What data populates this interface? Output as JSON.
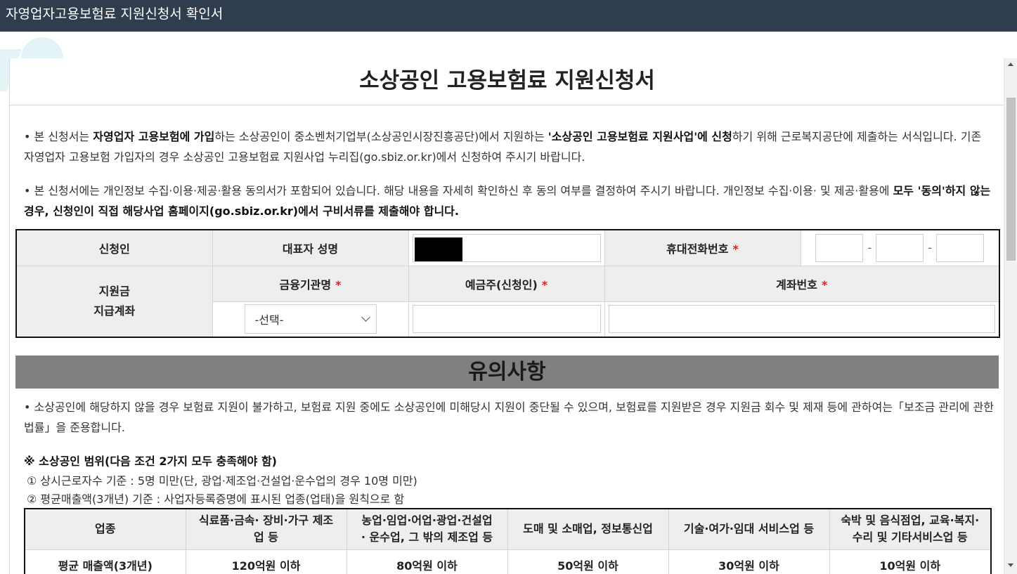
{
  "window": {
    "title": "자영업자고용보험료 지원신청서 확인서"
  },
  "document": {
    "title": "소상공인 고용보험료 지원신청서",
    "intro1": [
      {
        "t": "• 본 신청서는 ",
        "b": false
      },
      {
        "t": "자영업자 고용보험에 가입",
        "b": true
      },
      {
        "t": "하는 소상공인이 중소벤처기업부(소상공인시장진흥공단)에서 지원하는 ",
        "b": false
      },
      {
        "t": "'소상공인 고용보험료 지원사업'에 신청",
        "b": true
      },
      {
        "t": "하기 위해 근로복지공단에 제출하는 서식입니다. 기존 자영업자 고용보험 가입자의 경우 소상공인 고용보험료 지원사업 누리집(go.sbiz.or.kr)에서 신청하여 주시기 바랍니다.",
        "b": false
      }
    ],
    "intro2": [
      {
        "t": "• 본 신청서에는 개인정보 수집·이용·제공·활용 동의서가 포함되어 있습니다. 해당 내용을 자세히 확인하신 후 동의 여부를 결정하여 주시기 바랍니다. 개인정보 수집·이용· 및 제공·활용에 ",
        "b": false
      },
      {
        "t": "모두 '동의'하지 않는 경우, 신청인이 직접 해당사업 홈페이지(go.sbiz.or.kr)에서 구비서류를 제출해야 합니다.",
        "b": true
      }
    ]
  },
  "form": {
    "applicant_label": "신청인",
    "rep_name_label": "대표자 성명",
    "rep_name_value": "",
    "phone_label": "휴대전화번호",
    "required_mark": "*",
    "phone_dash": "-",
    "phone_parts": [
      "",
      "",
      ""
    ],
    "account_section_label_1": "지원금",
    "account_section_label_2": "지급계좌",
    "bank_label": "금융기관명",
    "holder_label": "예금주(신청인)",
    "account_label": "계좌번호",
    "bank_select_value": "-선택-",
    "holder_value": "",
    "account_value": ""
  },
  "notice": {
    "header": "유의사항",
    "text": "• 소상공인에 해당하지 않을 경우 보험료 지원이 불가하고, 보험료 지원 중에도 소상공인에 미해당시 지원이 중단될 수 있으며, 보험료를 지원받은 경우 지원금 회수 및 제재 등에 관하여는「보조금 관리에 관한 법률」을 준용합니다.",
    "scope_title": "※ 소상공인 범위(다음 조건 2가지 모두 충족해야 함)",
    "criteria": [
      "① 상시근로자수 기준 : 5명 미만(단, 광업·제조업·건설업·운수업의 경우 10명 미만)",
      "② 평균매출액(3개년) 기준 : 사업자등록증명에 표시된 업종(업태)을 원칙으로 함"
    ]
  },
  "table": {
    "headers": [
      [
        "업종"
      ],
      [
        "식료품·금속· 장비·가구 제조",
        "업 등"
      ],
      [
        "농업·임업·어업·광업·건설업",
        "· 운수업, 그 밖의 제조업 등"
      ],
      [
        "도매 및 소매업, 정보통신업"
      ],
      [
        "기술·여가·임대 서비스업 등"
      ],
      [
        "숙박 및 음식점업, 교육·복지·",
        "수리 및 기타서비스업 등"
      ]
    ],
    "row": [
      "평균 매출액(3개년)",
      "120억원 이하",
      "80억원 이하",
      "50억원 이하",
      "30억원 이하",
      "10억원 이하"
    ]
  }
}
